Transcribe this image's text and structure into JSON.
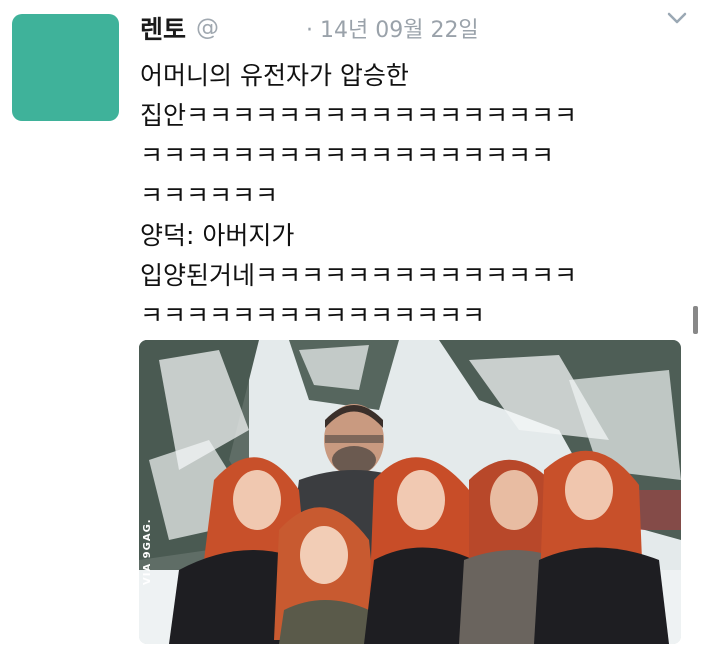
{
  "user": {
    "display_name": "렌토",
    "handle": "@",
    "timestamp": "· 14년 09월 22일"
  },
  "icons": {
    "menu": "chevron-down-icon"
  },
  "tweet": {
    "lines": [
      "어머니의 유전자가 압승한",
      "집안ㅋㅋㅋㅋㅋㅋㅋㅋㅋㅋㅋㅋㅋㅋㅋㅋㅋ",
      "ㅋㅋㅋㅋㅋㅋㅋㅋㅋㅋㅋㅋㅋㅋㅋㅋㅋㅋ",
      "ㅋㅋㅋㅋㅋㅋ",
      "양덕: 아버지가",
      "입양된거네ㅋㅋㅋㅋㅋㅋㅋㅋㅋㅋㅋㅋㅋㅋ",
      "ㅋㅋㅋㅋㅋㅋㅋㅋㅋㅋㅋㅋㅋㅋㅋ"
    ]
  },
  "media": {
    "watermark": "VIA 9GAG.",
    "colors": {
      "hair": "#c8502a",
      "snow": "#e9eff0",
      "trees": "#4a5a52",
      "coats": "#1e1e22"
    }
  }
}
